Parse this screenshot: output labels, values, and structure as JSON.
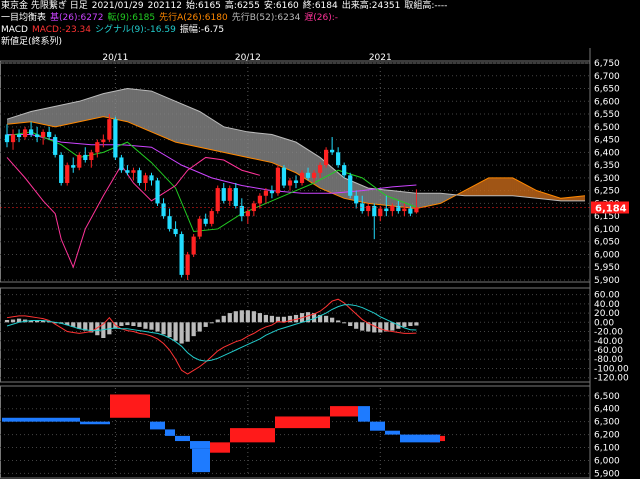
{
  "header": {
    "line1": {
      "instrument": "東京金 先限繋ぎ 日足",
      "date": "2021/01/29",
      "contract": "202112",
      "open": "始:6165",
      "high": "高:6255",
      "low": "安:6160",
      "close": "終:6184",
      "volume": "出来高:24351",
      "oi": "取組高:----"
    },
    "line2": {
      "label": "一目均衡表",
      "base": "基(26):6272",
      "conv": "転(9):6185",
      "spanA": "先行A(26):6180",
      "spanB": "先行B(52):6234",
      "lag": "遅(26):-",
      "colors": {
        "base": "#cc44ff",
        "conv": "#22cc22",
        "spanA": "#ff8800",
        "spanB": "#bbbbbb",
        "lag": "#ff3399"
      }
    },
    "line3": {
      "label": "MACD",
      "macd": "MACD:-23.34",
      "signal": "シグナル(9):-16.59",
      "osc": "振幅:-6.75",
      "colors": {
        "macd": "#ff3333",
        "signal": "#22cccc",
        "osc": "#ffffff"
      }
    },
    "line4": {
      "label": "新値足(終系列)"
    }
  },
  "current_price_label": "6,184",
  "chart_data": [
    {
      "type": "candlestick",
      "name": "price",
      "x_labels": [
        "20/11",
        "20/12",
        "2021"
      ],
      "y_ticks": [
        "6,750",
        "6,700",
        "6,650",
        "6,600",
        "6,550",
        "6,500",
        "6,450",
        "6,400",
        "6,350",
        "6,300",
        "6,250",
        "6,200",
        "6,150",
        "6,100",
        "6,050",
        "6,000",
        "5,950",
        "5,900"
      ],
      "ylim": [
        5900,
        6750
      ],
      "last_close": 6184,
      "candles": [
        [
          6470,
          6510,
          6420,
          6440
        ],
        [
          6440,
          6490,
          6410,
          6470
        ],
        [
          6470,
          6490,
          6440,
          6460
        ],
        [
          6460,
          6500,
          6450,
          6490
        ],
        [
          6490,
          6520,
          6460,
          6470
        ],
        [
          6470,
          6500,
          6440,
          6460
        ],
        [
          6460,
          6490,
          6430,
          6480
        ],
        [
          6480,
          6500,
          6450,
          6460
        ],
        [
          6460,
          6470,
          6380,
          6390
        ],
        [
          6390,
          6400,
          6270,
          6280
        ],
        [
          6280,
          6360,
          6270,
          6350
        ],
        [
          6350,
          6380,
          6320,
          6340
        ],
        [
          6340,
          6400,
          6330,
          6390
        ],
        [
          6390,
          6420,
          6360,
          6370
        ],
        [
          6370,
          6410,
          6340,
          6400
        ],
        [
          6400,
          6450,
          6380,
          6440
        ],
        [
          6440,
          6470,
          6420,
          6450
        ],
        [
          6450,
          6550,
          6440,
          6530
        ],
        [
          6530,
          6540,
          6370,
          6380
        ],
        [
          6380,
          6390,
          6320,
          6330
        ],
        [
          6330,
          6350,
          6310,
          6320
        ],
        [
          6320,
          6340,
          6290,
          6330
        ],
        [
          6330,
          6340,
          6270,
          6280
        ],
        [
          6280,
          6320,
          6250,
          6310
        ],
        [
          6310,
          6320,
          6270,
          6290
        ],
        [
          6290,
          6300,
          6190,
          6200
        ],
        [
          6200,
          6220,
          6140,
          6150
        ],
        [
          6150,
          6180,
          6090,
          6100
        ],
        [
          6100,
          6130,
          6070,
          6080
        ],
        [
          6080,
          6090,
          5910,
          5920
        ],
        [
          5920,
          6010,
          5900,
          6000
        ],
        [
          6000,
          6080,
          5990,
          6070
        ],
        [
          6070,
          6150,
          6060,
          6140
        ],
        [
          6140,
          6160,
          6110,
          6120
        ],
        [
          6120,
          6180,
          6110,
          6170
        ],
        [
          6170,
          6270,
          6160,
          6260
        ],
        [
          6260,
          6280,
          6200,
          6210
        ],
        [
          6210,
          6270,
          6190,
          6260
        ],
        [
          6260,
          6280,
          6180,
          6190
        ],
        [
          6190,
          6220,
          6130,
          6150
        ],
        [
          6150,
          6180,
          6120,
          6170
        ],
        [
          6170,
          6210,
          6150,
          6200
        ],
        [
          6200,
          6240,
          6180,
          6230
        ],
        [
          6230,
          6260,
          6200,
          6250
        ],
        [
          6250,
          6270,
          6220,
          6240
        ],
        [
          6240,
          6350,
          6230,
          6340
        ],
        [
          6340,
          6350,
          6260,
          6270
        ],
        [
          6270,
          6300,
          6250,
          6290
        ],
        [
          6290,
          6310,
          6260,
          6280
        ],
        [
          6280,
          6330,
          6270,
          6320
        ],
        [
          6320,
          6340,
          6290,
          6300
        ],
        [
          6300,
          6330,
          6280,
          6320
        ],
        [
          6320,
          6360,
          6300,
          6350
        ],
        [
          6350,
          6420,
          6340,
          6410
        ],
        [
          6410,
          6460,
          6390,
          6400
        ],
        [
          6400,
          6420,
          6340,
          6350
        ],
        [
          6350,
          6360,
          6300,
          6310
        ],
        [
          6310,
          6320,
          6220,
          6230
        ],
        [
          6230,
          6250,
          6180,
          6200
        ],
        [
          6200,
          6230,
          6160,
          6170
        ],
        [
          6170,
          6200,
          6150,
          6190
        ],
        [
          6190,
          6200,
          6060,
          6150
        ],
        [
          6150,
          6190,
          6130,
          6180
        ],
        [
          6180,
          6230,
          6150,
          6170
        ],
        [
          6170,
          6200,
          6150,
          6190
        ],
        [
          6190,
          6210,
          6160,
          6170
        ],
        [
          6170,
          6200,
          6150,
          6180
        ],
        [
          6180,
          6190,
          6150,
          6160
        ],
        [
          6165,
          6255,
          6160,
          6184
        ]
      ],
      "series": [
        {
          "name": "基(26)",
          "color": "#cc44ff",
          "points": [
            [
              0,
              6470
            ],
            [
              4,
              6470
            ],
            [
              9,
              6440
            ],
            [
              14,
              6430
            ],
            [
              19,
              6430
            ],
            [
              24,
              6420
            ],
            [
              29,
              6350
            ],
            [
              34,
              6300
            ],
            [
              39,
              6270
            ],
            [
              44,
              6250
            ],
            [
              49,
              6240
            ],
            [
              54,
              6240
            ],
            [
              59,
              6250
            ],
            [
              64,
              6265
            ],
            [
              68,
              6272
            ]
          ]
        },
        {
          "name": "転(9)",
          "color": "#22cc22",
          "points": [
            [
              0,
              6465
            ],
            [
              4,
              6480
            ],
            [
              9,
              6430
            ],
            [
              12,
              6380
            ],
            [
              16,
              6400
            ],
            [
              20,
              6440
            ],
            [
              24,
              6360
            ],
            [
              28,
              6260
            ],
            [
              31,
              6090
            ],
            [
              35,
              6100
            ],
            [
              39,
              6160
            ],
            [
              43,
              6200
            ],
            [
              47,
              6240
            ],
            [
              51,
              6280
            ],
            [
              55,
              6330
            ],
            [
              59,
              6300
            ],
            [
              63,
              6230
            ],
            [
              68,
              6185
            ]
          ]
        },
        {
          "name": "遅(26)",
          "color": "#ff3399",
          "points": [
            [
              0,
              6380
            ],
            [
              3,
              6300
            ],
            [
              6,
              6210
            ],
            [
              8,
              6160
            ],
            [
              9,
              6060
            ],
            [
              11,
              5950
            ],
            [
              13,
              6100
            ],
            [
              16,
              6230
            ],
            [
              19,
              6350
            ],
            [
              21,
              6280
            ],
            [
              24,
              6210
            ],
            [
              26,
              6240
            ],
            [
              28,
              6270
            ],
            [
              30,
              6330
            ],
            [
              33,
              6380
            ],
            [
              36,
              6370
            ],
            [
              39,
              6330
            ],
            [
              42,
              6310
            ]
          ]
        }
      ],
      "cloud": {
        "spanA_color": "#ff8800",
        "spanB_color": "#bbbbbb",
        "spanA": [
          [
            0,
            6510
          ],
          [
            4,
            6520
          ],
          [
            8,
            6500
          ],
          [
            12,
            6520
          ],
          [
            16,
            6540
          ],
          [
            20,
            6520
          ],
          [
            24,
            6480
          ],
          [
            28,
            6440
          ],
          [
            32,
            6420
          ],
          [
            36,
            6400
          ],
          [
            40,
            6380
          ],
          [
            44,
            6360
          ],
          [
            48,
            6320
          ],
          [
            52,
            6260
          ],
          [
            56,
            6220
          ],
          [
            60,
            6200
          ],
          [
            64,
            6190
          ],
          [
            68,
            6180
          ],
          [
            72,
            6200
          ],
          [
            76,
            6250
          ],
          [
            80,
            6300
          ],
          [
            84,
            6300
          ],
          [
            88,
            6250
          ],
          [
            92,
            6220
          ],
          [
            96,
            6230
          ]
        ],
        "spanB": [
          [
            0,
            6530
          ],
          [
            4,
            6560
          ],
          [
            8,
            6580
          ],
          [
            12,
            6600
          ],
          [
            16,
            6630
          ],
          [
            20,
            6650
          ],
          [
            24,
            6640
          ],
          [
            28,
            6600
          ],
          [
            32,
            6560
          ],
          [
            36,
            6500
          ],
          [
            40,
            6480
          ],
          [
            44,
            6470
          ],
          [
            48,
            6440
          ],
          [
            52,
            6380
          ],
          [
            56,
            6300
          ],
          [
            60,
            6260
          ],
          [
            64,
            6250
          ],
          [
            68,
            6240
          ],
          [
            72,
            6240
          ],
          [
            76,
            6230
          ],
          [
            80,
            6230
          ],
          [
            84,
            6230
          ],
          [
            88,
            6220
          ],
          [
            92,
            6210
          ],
          [
            96,
            6210
          ]
        ]
      }
    },
    {
      "type": "bar",
      "name": "macd",
      "y_ticks": [
        "60.00",
        "40.00",
        "20.00",
        "0.00",
        "-20.00",
        "-40.00",
        "-60.00",
        "-80.00",
        "-100.00",
        "-120.00"
      ],
      "ylim": [
        -125,
        70
      ],
      "osc": [
        5,
        6,
        8,
        6,
        4,
        4,
        3,
        2,
        0,
        -3,
        -6,
        -10,
        -14,
        -18,
        -22,
        -28,
        -34,
        -26,
        -14,
        -8,
        -6,
        -8,
        -10,
        -14,
        -16,
        -20,
        -26,
        -32,
        -40,
        -46,
        -42,
        -30,
        -20,
        -10,
        0,
        6,
        14,
        20,
        24,
        26,
        26,
        24,
        20,
        16,
        14,
        12,
        12,
        14,
        16,
        20,
        22,
        20,
        16,
        14,
        10,
        4,
        -2,
        -8,
        -14,
        -18,
        -20,
        -22,
        -22,
        -20,
        -18,
        -14,
        -10,
        -8,
        -7
      ],
      "macd": [
        10,
        12,
        14,
        14,
        12,
        10,
        8,
        4,
        -4,
        -12,
        -20,
        -22,
        -24,
        -22,
        -20,
        -12,
        -4,
        10,
        -6,
        -14,
        -18,
        -20,
        -24,
        -26,
        -30,
        -36,
        -46,
        -60,
        -80,
        -104,
        -112,
        -104,
        -96,
        -86,
        -74,
        -62,
        -54,
        -48,
        -42,
        -38,
        -30,
        -24,
        -16,
        -10,
        -6,
        2,
        0,
        4,
        6,
        10,
        14,
        18,
        24,
        34,
        46,
        50,
        42,
        30,
        18,
        6,
        -2,
        -8,
        -14,
        -18,
        -20,
        -22,
        -24,
        -24,
        -23.34
      ],
      "signal": [
        -8,
        -4,
        0,
        2,
        4,
        4,
        4,
        2,
        0,
        -2,
        -6,
        -10,
        -14,
        -16,
        -18,
        -18,
        -16,
        -14,
        -12,
        -14,
        -14,
        -16,
        -18,
        -20,
        -22,
        -24,
        -28,
        -34,
        -42,
        -52,
        -66,
        -76,
        -82,
        -84,
        -82,
        -78,
        -72,
        -66,
        -60,
        -54,
        -48,
        -42,
        -36,
        -28,
        -22,
        -16,
        -12,
        -8,
        -4,
        0,
        4,
        8,
        14,
        20,
        28,
        34,
        38,
        38,
        36,
        32,
        26,
        20,
        12,
        6,
        0,
        -6,
        -12,
        -16,
        -16.59
      ]
    },
    {
      "type": "bar",
      "name": "new-price-bars",
      "y_ticks": [
        "6,500",
        "6,400",
        "6,300",
        "6,200",
        "6,100",
        "6,000",
        "5,900"
      ],
      "ylim": [
        5880,
        6560
      ],
      "bars": [
        [
          0,
          0,
          6330,
          6300
        ],
        [
          1,
          1,
          6330,
          6300
        ],
        [
          2,
          2,
          6300,
          6280
        ],
        [
          3,
          3,
          6330,
          6510
        ],
        [
          4,
          4,
          6300,
          6240
        ],
        [
          5,
          5,
          6240,
          6190
        ],
        [
          6,
          6,
          6190,
          6150
        ],
        [
          7,
          7,
          6150,
          6090
        ],
        [
          8,
          8,
          6090,
          5910
        ],
        [
          9,
          9,
          6060,
          6140
        ],
        [
          10,
          10,
          6140,
          6250
        ],
        [
          11,
          11,
          6250,
          6340
        ],
        [
          12,
          12,
          6340,
          6420
        ],
        [
          13,
          13,
          6420,
          6300
        ],
        [
          14,
          14,
          6300,
          6230
        ],
        [
          15,
          15,
          6230,
          6200
        ],
        [
          16,
          16,
          6200,
          6140
        ],
        [
          17,
          17,
          6140,
          6200
        ],
        [
          18,
          18,
          6200,
          6140
        ],
        [
          19,
          19,
          6150,
          6190
        ]
      ]
    }
  ]
}
